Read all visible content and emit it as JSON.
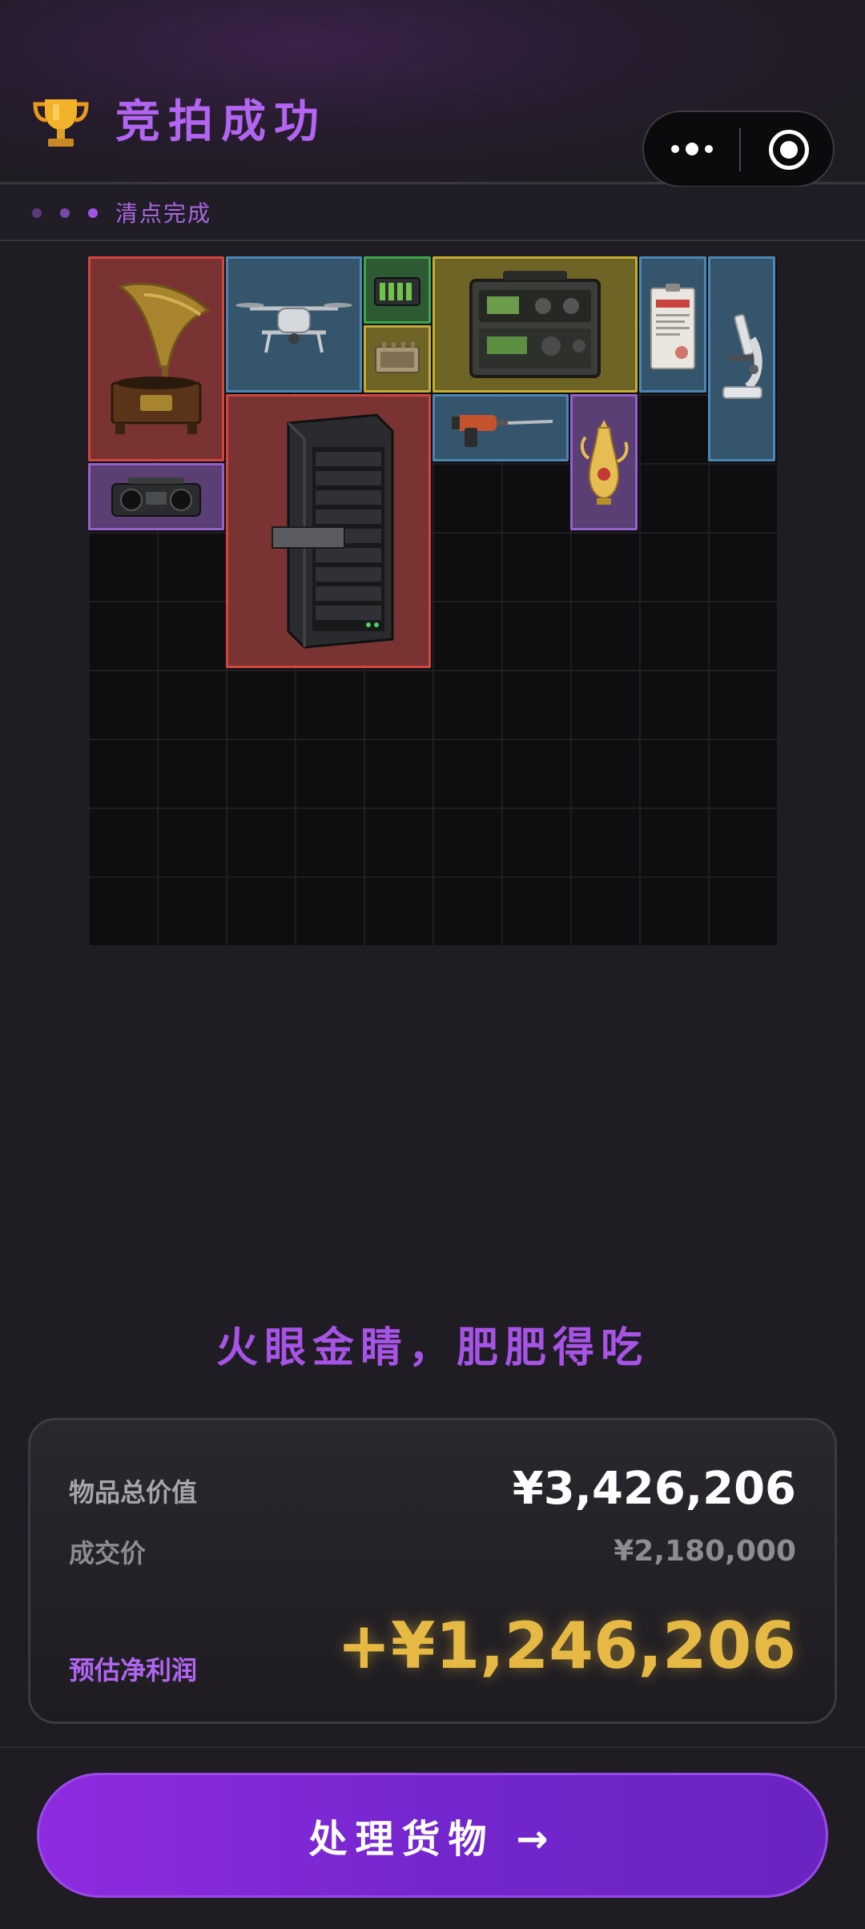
{
  "header": {
    "title": "竞拍成功",
    "trophy_icon": "trophy-icon",
    "menu": {
      "more_icon": "more-dots-icon",
      "close_icon": "mini-program-close-icon"
    }
  },
  "steps": {
    "label": "清点完成",
    "dot_colors": [
      "#5a3a78",
      "#7a48a8",
      "#a354e6"
    ]
  },
  "inventory": {
    "items": [
      {
        "name": "gramophone",
        "rarity": "red"
      },
      {
        "name": "drone",
        "rarity": "blue"
      },
      {
        "name": "battery-pack",
        "rarity": "green"
      },
      {
        "name": "military-radio",
        "rarity": "gold"
      },
      {
        "name": "confidential-document",
        "rarity": "blue"
      },
      {
        "name": "microscope",
        "rarity": "blue"
      },
      {
        "name": "circuit-module",
        "rarity": "gold"
      },
      {
        "name": "server-rack",
        "rarity": "red"
      },
      {
        "name": "power-drill",
        "rarity": "blue"
      },
      {
        "name": "golden-ewer",
        "rarity": "purple"
      },
      {
        "name": "boombox",
        "rarity": "purple"
      }
    ],
    "rarity_colors": {
      "red": "#d0463e",
      "blue": "#4d86b4",
      "green": "#3fa54d",
      "gold": "#c4ac35",
      "purple": "#9560c9"
    }
  },
  "slogan": "火眼金睛，肥肥得吃",
  "summary": {
    "total_label": "物品总价值",
    "total_value": "¥3,426,206",
    "deal_label": "成交价",
    "deal_value": "¥2,180,000",
    "profit_label": "预估净利润",
    "profit_value": "+¥1,246,206",
    "profit_color": "#e5b944",
    "accent_color": "#b165f0"
  },
  "cta": {
    "label": "处理货物 →"
  }
}
